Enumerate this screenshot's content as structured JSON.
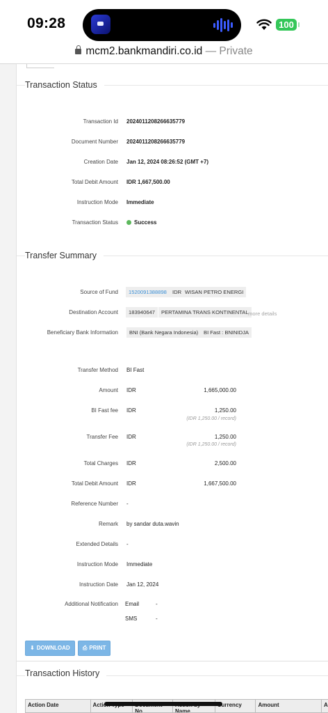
{
  "status_bar": {
    "time": "09:28",
    "battery": "100"
  },
  "browser": {
    "host": "mcm2.bankmandiri.co.id",
    "mode": "— Private"
  },
  "transaction_status": {
    "title": "Transaction Status",
    "rows": [
      {
        "label": "Transaction Id",
        "value": "2024011208266635779"
      },
      {
        "label": "Document Number",
        "value": "2024011208266635779"
      },
      {
        "label": "Creation Date",
        "value": "Jan 12, 2024 08:26:52 (GMT +7)"
      },
      {
        "label": "Total Debit Amount",
        "value": "IDR 1,667,500.00"
      },
      {
        "label": "Instruction Mode",
        "value": "Immediate"
      },
      {
        "label": "Transaction Status",
        "value": "Success"
      }
    ]
  },
  "transfer_summary": {
    "title": "Transfer Summary",
    "source_of_fund": {
      "label": "Source of Fund",
      "account": "1520091388898",
      "currency": "IDR",
      "name": "WISAN PETRO ENERGI"
    },
    "destination_account": {
      "label": "Destination Account",
      "account": "183940647",
      "name": "PERTAMINA TRANS KONTINENTAL",
      "more": "more details"
    },
    "beneficiary_bank": {
      "label": "Beneficiary Bank Information",
      "bank": "BNI (Bank Negara Indonesia)",
      "code": "BI Fast : BNINIDJA"
    },
    "transfer_method": {
      "label": "Transfer Method",
      "value": "BI Fast"
    },
    "amount": {
      "label": "Amount",
      "currency": "IDR",
      "value": "1,665,000.00"
    },
    "bi_fast_fee": {
      "label": "BI Fast fee",
      "currency": "IDR",
      "value": "1,250.00",
      "note": "(IDR 1,250.00 / record)"
    },
    "transfer_fee": {
      "label": "Transfer Fee",
      "currency": "IDR",
      "value": "1,250.00",
      "note": "(IDR 1,250.00 / record)"
    },
    "total_charges": {
      "label": "Total Charges",
      "currency": "IDR",
      "value": "2,500.00"
    },
    "total_debit": {
      "label": "Total Debit Amount",
      "currency": "IDR",
      "value": "1,667,500.00"
    },
    "reference_number": {
      "label": "Reference Number",
      "value": "-"
    },
    "remark": {
      "label": "Remark",
      "value": "by sandar duta.wavin"
    },
    "extended_details": {
      "label": "Extended Details",
      "value": "-"
    },
    "instruction_mode": {
      "label": "Instruction Mode",
      "value": "Immediate"
    },
    "instruction_date": {
      "label": "Instruction Date",
      "value": "Jan 12, 2024"
    },
    "additional_notification": {
      "label": "Additional Notification",
      "email_label": "Email",
      "email_value": "-",
      "sms_label": "SMS",
      "sms_value": "-"
    }
  },
  "actions": {
    "download": "DOWNLOAD",
    "print": "PRINT"
  },
  "transaction_history": {
    "title": "Transaction History",
    "columns": [
      "Action Date",
      "Action Type",
      "Document No",
      "Action by Name",
      "Currency",
      "Amount",
      "Ac"
    ]
  },
  "colors": {
    "accent_blue": "#7cb6e6",
    "link_blue": "#3a8fd6",
    "success_green": "#5cb85c",
    "battery_green": "#34c759"
  }
}
